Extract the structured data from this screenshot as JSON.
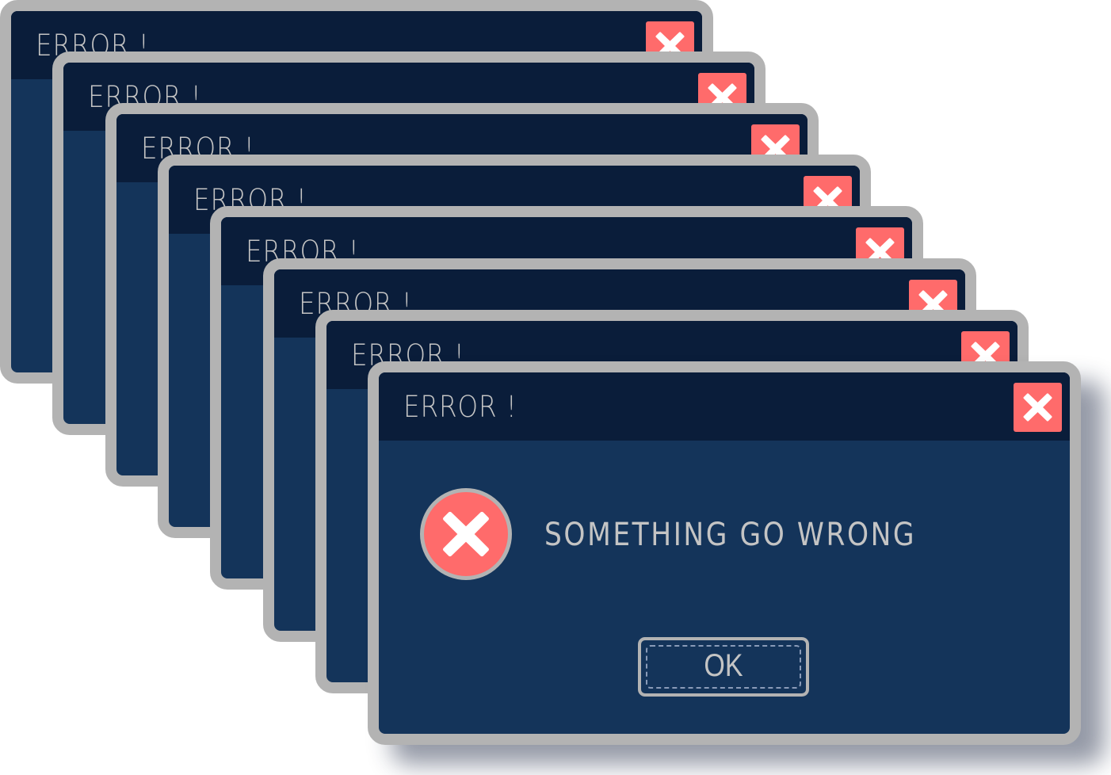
{
  "windows": [
    {
      "title": "ERROR !"
    },
    {
      "title": "ERROR !"
    },
    {
      "title": "ERROR !"
    },
    {
      "title": "ERROR !"
    },
    {
      "title": "ERROR !"
    },
    {
      "title": "ERROR !"
    },
    {
      "title": "ERROR !"
    },
    {
      "title": "ERROR !"
    }
  ],
  "dialog": {
    "title": "ERROR !",
    "message": "SOMETHING GO WRONG",
    "ok_label": "OK",
    "icon": "error-x-circle-icon",
    "close_icon": "close-x-icon"
  },
  "colors": {
    "border": "#b3b3b3",
    "title_bar": "#0a1d3a",
    "body": "#14345a",
    "danger": "#ff6b6b",
    "text": "#c4c4c4"
  }
}
